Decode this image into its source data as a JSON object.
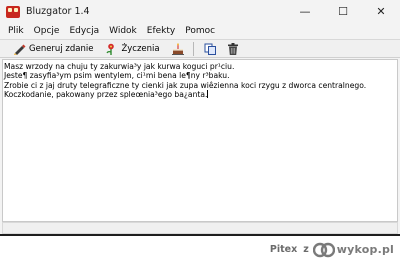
{
  "window": {
    "title": "Bluzgator 1.4",
    "controls": {
      "minimize": "—",
      "maximize": "☐",
      "close": "✕"
    }
  },
  "menu": [
    "Plik",
    "Opcje",
    "Edycja",
    "Widok",
    "Efekty",
    "Pomoc"
  ],
  "toolbar": {
    "generate_label": "Generuj zdanie",
    "wishes_label": "Życzenia"
  },
  "editor": {
    "lines": [
      "Masz wrzody na chuju ty zakurwia³y jak kurwa koguci pr¹ciu.",
      "Jeste¶ zasyfia³ym psim wentylem, ci¹mi bena le¶ny r³baku.",
      "Zrobie ci z jaj druty telegraficzne ty cienki jak zupa wiêzienna koci rzygu z dworca centralnego.",
      "Koczkodanie, pakowany przez spleœnia³ego ba¿anta."
    ]
  },
  "footer": {
    "user": "Pitex",
    "z": "z",
    "logo": "wykop.pl"
  },
  "colors": {
    "window_bg": "#f3f3f3",
    "editor_bg": "#ffffff",
    "logo_accent": "#7a7a7a"
  }
}
